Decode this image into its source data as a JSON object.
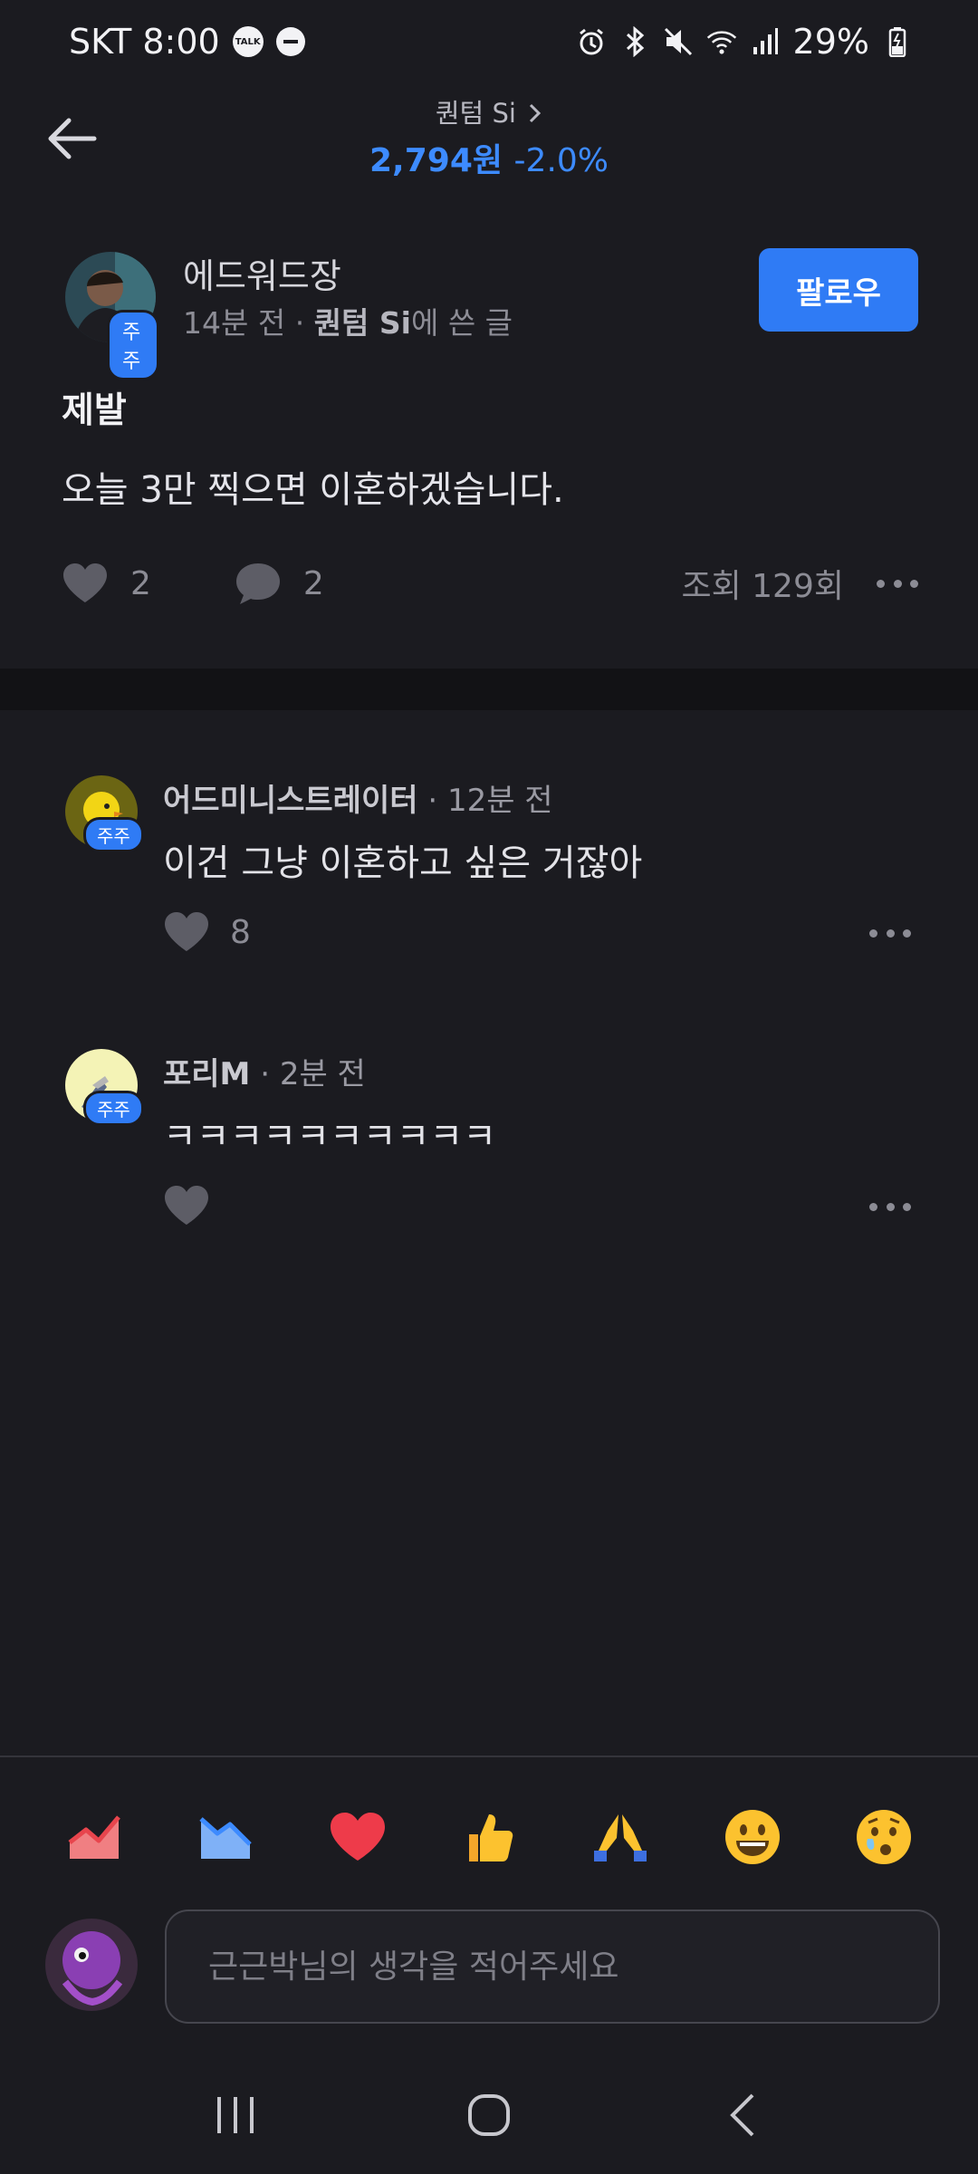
{
  "status_bar": {
    "carrier_time": "SKT 8:00",
    "talk_label": "TALK",
    "battery": "29%",
    "icons": [
      "talk-icon",
      "dnd-icon",
      "alarm-icon",
      "bluetooth-icon",
      "mute-icon",
      "wifi-icon",
      "signal-icon",
      "battery-icon"
    ]
  },
  "header": {
    "stock_name": "퀀텀 Si",
    "price": "2,794원",
    "change": "-2.0%",
    "price_color": "#3d8bff"
  },
  "post": {
    "author": "에드워드장",
    "badge": "주주",
    "time": "14분 전",
    "meta_sep": " · ",
    "board": "퀀텀 Si",
    "board_suffix": "에 쓴 글",
    "follow_label": "팔로우",
    "title": "제발",
    "body": "오늘 3만 찍으면 이혼하겠습니다.",
    "likes": "2",
    "comments": "2",
    "views": "조회 129회"
  },
  "comments": [
    {
      "name": "어드미니스트레이터",
      "time": " · 12분 전",
      "badge": "주주",
      "text": "이건 그냥 이혼하고 싶은 거잖아",
      "likes": "8"
    },
    {
      "name": "포리M",
      "time": " · 2분 전",
      "badge": "주주",
      "text": "ㅋㅋㅋㅋㅋㅋㅋㅋㅋㅋ",
      "likes": ""
    }
  ],
  "reactions": [
    "chart-up-icon",
    "chart-down-icon",
    "heart-icon",
    "thumbs-up-icon",
    "pray-icon",
    "smile-icon",
    "surprised-icon"
  ],
  "composer": {
    "placeholder": "근근박님의 생각을 적어주세요"
  },
  "colors": {
    "background": "#1b1b20",
    "accent": "#2f7bf5"
  }
}
